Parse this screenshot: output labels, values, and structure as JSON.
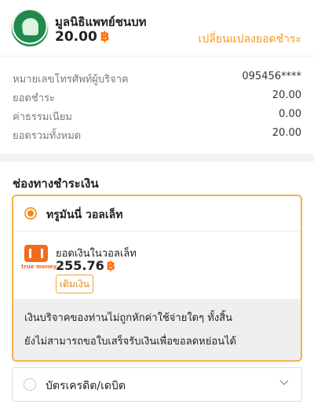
{
  "header": {
    "org_name": "มูลนิธิแพทย์ชนบท",
    "amount": "20.00",
    "currency_symbol": "฿",
    "change_amount_link": "เปลี่ยนแปลงยอดชำระ"
  },
  "details": [
    {
      "label": "หมายเลขโทรศัพท์ผู้บริจาค",
      "value": "095456****"
    },
    {
      "label": "ยอดชำระ",
      "value": "20.00"
    },
    {
      "label": "ค่าธรรมเนียม",
      "value": "0.00"
    },
    {
      "label": "ยอดรวมทั้งหมด",
      "value": "20.00"
    }
  ],
  "payment": {
    "section_title": "ช่องทางชำระเงิน",
    "wallet": {
      "label": "ทรูมันนี่ วอลเล็ท",
      "brand": "truemoney",
      "balance_label": "ยอดเงินในวอลเล็ท",
      "balance": "255.76",
      "currency_symbol": "฿",
      "topup_label": "เติมเงิน",
      "note_line1": "เงินบริจาคของท่านไม่ถูกหักค่าใช้จ่ายใดๆ ทั้งสิ้น",
      "note_line2": "ยังไม่สามารถขอใบเสร็จรับเงินเพื่อขอลดหย่อนได้",
      "selected": true
    },
    "credit": {
      "label": "บัตรเครดิต/เดบิต",
      "selected": false
    }
  },
  "colors": {
    "accent": "#f5841f",
    "accent_border": "#f4b14a",
    "truemoney": "#f26b21"
  },
  "icons": [
    "foundation-logo",
    "radio-selected-icon",
    "truemoney-logo",
    "radio-unselected-icon",
    "chevron-down-icon"
  ]
}
